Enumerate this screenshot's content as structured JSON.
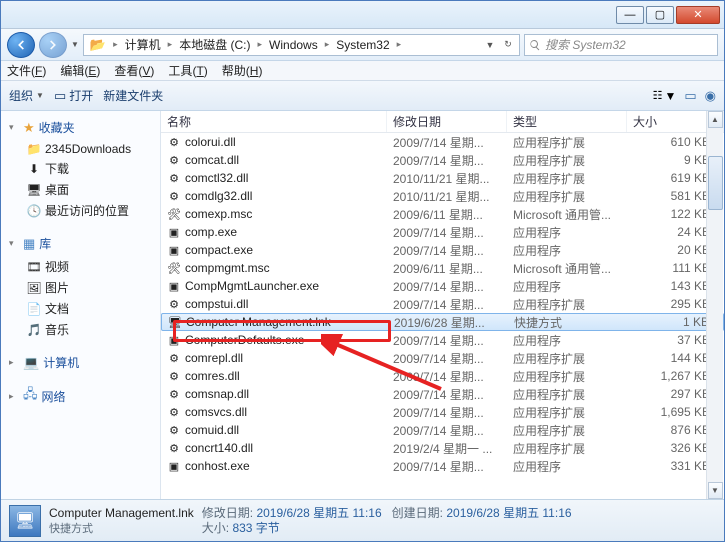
{
  "window_controls": {
    "min": "—",
    "max": "▢",
    "close": "✕"
  },
  "breadcrumb": {
    "items": [
      "计算机",
      "本地磁盘 (C:)",
      "Windows",
      "System32"
    ]
  },
  "search": {
    "placeholder": "搜索 System32"
  },
  "menu": {
    "items": [
      {
        "label": "文件",
        "key": "F"
      },
      {
        "label": "编辑",
        "key": "E"
      },
      {
        "label": "查看",
        "key": "V"
      },
      {
        "label": "工具",
        "key": "T"
      },
      {
        "label": "帮助",
        "key": "H"
      }
    ]
  },
  "toolbar": {
    "organize": "组织",
    "open": "打开",
    "new_folder": "新建文件夹"
  },
  "sidebar": {
    "favorites": {
      "label": "收藏夹",
      "items": [
        "2345Downloads",
        "下载",
        "桌面",
        "最近访问的位置"
      ]
    },
    "libraries": {
      "label": "库",
      "items": [
        "视频",
        "图片",
        "文档",
        "音乐"
      ]
    },
    "computer": {
      "label": "计算机"
    },
    "network": {
      "label": "网络"
    }
  },
  "columns": {
    "name": "名称",
    "date": "修改日期",
    "type": "类型",
    "size": "大小"
  },
  "files": [
    {
      "name": "colorui.dll",
      "date": "2009/7/14 星期...",
      "type": "应用程序扩展",
      "size": "610 KB",
      "icon": "dll"
    },
    {
      "name": "comcat.dll",
      "date": "2009/7/14 星期...",
      "type": "应用程序扩展",
      "size": "9 KB",
      "icon": "dll"
    },
    {
      "name": "comctl32.dll",
      "date": "2010/11/21 星期...",
      "type": "应用程序扩展",
      "size": "619 KB",
      "icon": "dll"
    },
    {
      "name": "comdlg32.dll",
      "date": "2010/11/21 星期...",
      "type": "应用程序扩展",
      "size": "581 KB",
      "icon": "dll"
    },
    {
      "name": "comexp.msc",
      "date": "2009/6/11 星期...",
      "type": "Microsoft 通用管...",
      "size": "122 KB",
      "icon": "msc"
    },
    {
      "name": "comp.exe",
      "date": "2009/7/14 星期...",
      "type": "应用程序",
      "size": "24 KB",
      "icon": "exe"
    },
    {
      "name": "compact.exe",
      "date": "2009/7/14 星期...",
      "type": "应用程序",
      "size": "20 KB",
      "icon": "exe"
    },
    {
      "name": "compmgmt.msc",
      "date": "2009/6/11 星期...",
      "type": "Microsoft 通用管...",
      "size": "111 KB",
      "icon": "msc"
    },
    {
      "name": "CompMgmtLauncher.exe",
      "date": "2009/7/14 星期...",
      "type": "应用程序",
      "size": "143 KB",
      "icon": "exe"
    },
    {
      "name": "compstui.dll",
      "date": "2009/7/14 星期...",
      "type": "应用程序扩展",
      "size": "295 KB",
      "icon": "dll"
    },
    {
      "name": "Computer Management.lnk",
      "date": "2019/6/28 星期...",
      "type": "快捷方式",
      "size": "1 KB",
      "icon": "lnk",
      "selected": true
    },
    {
      "name": "ComputerDefaults.exe",
      "date": "2009/7/14 星期...",
      "type": "应用程序",
      "size": "37 KB",
      "icon": "exe"
    },
    {
      "name": "comrepl.dll",
      "date": "2009/7/14 星期...",
      "type": "应用程序扩展",
      "size": "144 KB",
      "icon": "dll"
    },
    {
      "name": "comres.dll",
      "date": "2009/7/14 星期...",
      "type": "应用程序扩展",
      "size": "1,267 KB",
      "icon": "dll"
    },
    {
      "name": "comsnap.dll",
      "date": "2009/7/14 星期...",
      "type": "应用程序扩展",
      "size": "297 KB",
      "icon": "dll"
    },
    {
      "name": "comsvcs.dll",
      "date": "2009/7/14 星期...",
      "type": "应用程序扩展",
      "size": "1,695 KB",
      "icon": "dll"
    },
    {
      "name": "comuid.dll",
      "date": "2009/7/14 星期...",
      "type": "应用程序扩展",
      "size": "876 KB",
      "icon": "dll"
    },
    {
      "name": "concrt140.dll",
      "date": "2019/2/4 星期一 ...",
      "type": "应用程序扩展",
      "size": "326 KB",
      "icon": "dll"
    },
    {
      "name": "conhost.exe",
      "date": "2009/7/14 星期...",
      "type": "应用程序",
      "size": "331 KB",
      "icon": "exe"
    }
  ],
  "status": {
    "title": "Computer Management.lnk",
    "subtitle": "快捷方式",
    "mod_label": "修改日期:",
    "mod_value": "2019/6/28 星期五 11:16",
    "create_label": "创建日期:",
    "create_value": "2019/6/28 星期五 11:16",
    "size_label": "大小:",
    "size_value": "833 字节"
  }
}
